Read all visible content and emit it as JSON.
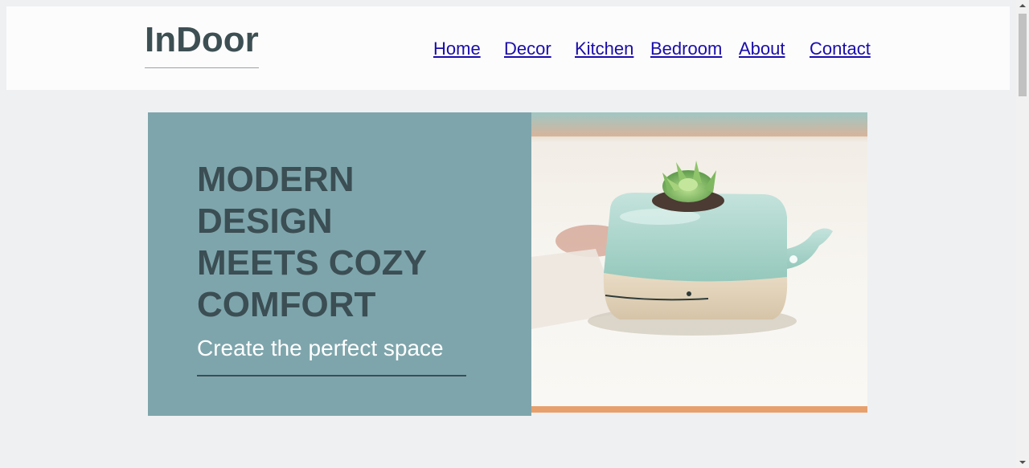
{
  "header": {
    "logo": "InDoor",
    "nav": [
      {
        "label": "Home"
      },
      {
        "label": "Decor"
      },
      {
        "label": "Kitchen"
      },
      {
        "label": "Bedroom"
      },
      {
        "label": "About"
      },
      {
        "label": "Contact"
      }
    ]
  },
  "hero": {
    "headline_lines": [
      "MODERN",
      "DESIGN",
      "MEETS COZY",
      "COMFORT"
    ],
    "subheading": "Create the perfect space"
  },
  "colors": {
    "page_bg": "#eef0f2",
    "header_bg": "#fcfcfc",
    "hero_panel": "#7ea5ac",
    "headline_text": "#3b4e53",
    "link": "#1a0dab"
  }
}
